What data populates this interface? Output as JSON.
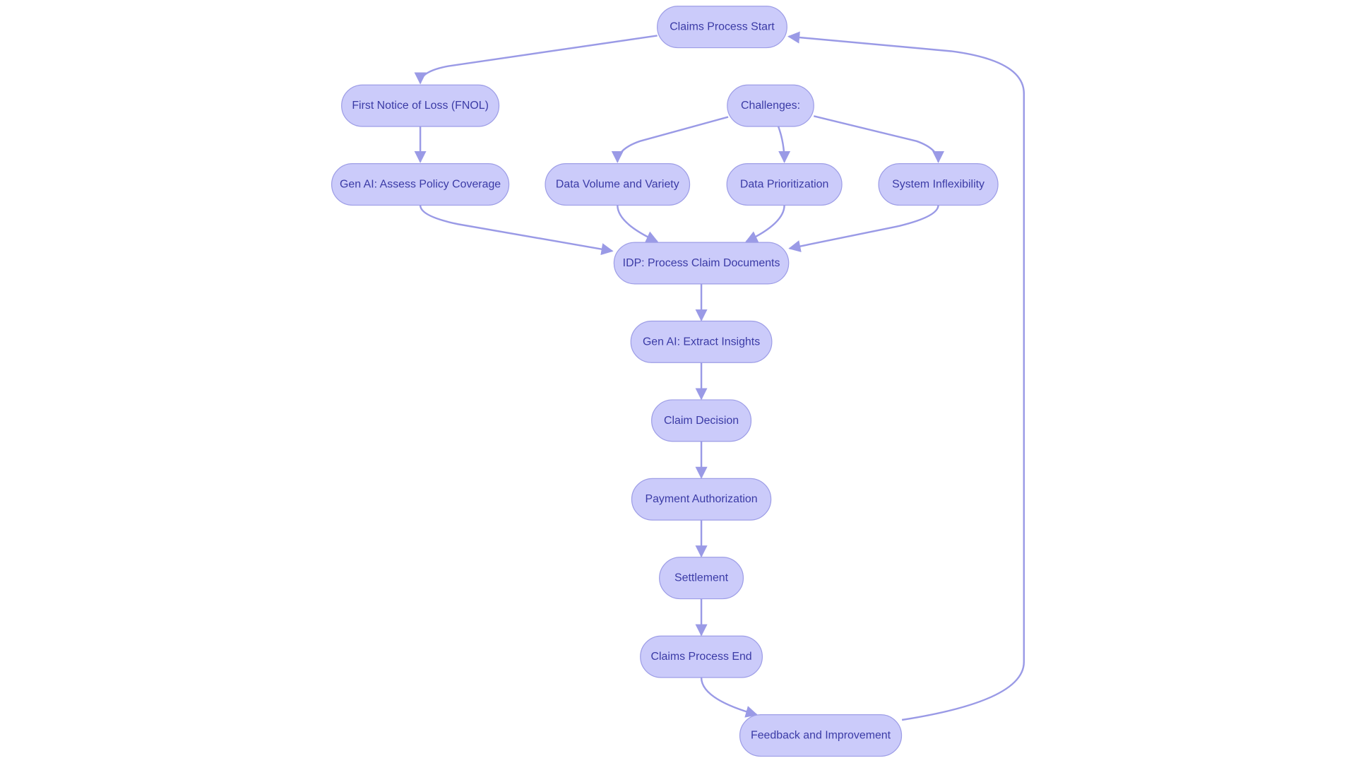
{
  "diagram": {
    "type": "flowchart",
    "colors": {
      "node_fill": "#cbcbfa",
      "node_stroke": "#9d9de6",
      "text": "#3b3ba6",
      "edge": "#9a9ae6"
    },
    "nodes": [
      {
        "id": "start",
        "label": "Claims Process Start"
      },
      {
        "id": "fnol",
        "label": "First Notice of Loss (FNOL)"
      },
      {
        "id": "challenges",
        "label": "Challenges:"
      },
      {
        "id": "assess",
        "label": "Gen AI: Assess Policy Coverage"
      },
      {
        "id": "volume",
        "label": "Data Volume and Variety"
      },
      {
        "id": "prior",
        "label": "Data Prioritization"
      },
      {
        "id": "inflex",
        "label": "System Inflexibility"
      },
      {
        "id": "idp",
        "label": "IDP: Process Claim Documents"
      },
      {
        "id": "extract",
        "label": "Gen AI: Extract Insights"
      },
      {
        "id": "decision",
        "label": "Claim Decision"
      },
      {
        "id": "payment",
        "label": "Payment Authorization"
      },
      {
        "id": "settle",
        "label": "Settlement"
      },
      {
        "id": "end",
        "label": "Claims Process End"
      },
      {
        "id": "feedback",
        "label": "Feedback and Improvement"
      }
    ],
    "edges": [
      {
        "from": "start",
        "to": "fnol"
      },
      {
        "from": "fnol",
        "to": "assess"
      },
      {
        "from": "challenges",
        "to": "volume"
      },
      {
        "from": "challenges",
        "to": "prior"
      },
      {
        "from": "challenges",
        "to": "inflex"
      },
      {
        "from": "assess",
        "to": "idp"
      },
      {
        "from": "volume",
        "to": "idp"
      },
      {
        "from": "prior",
        "to": "idp"
      },
      {
        "from": "inflex",
        "to": "idp"
      },
      {
        "from": "idp",
        "to": "extract"
      },
      {
        "from": "extract",
        "to": "decision"
      },
      {
        "from": "decision",
        "to": "payment"
      },
      {
        "from": "payment",
        "to": "settle"
      },
      {
        "from": "settle",
        "to": "end"
      },
      {
        "from": "end",
        "to": "feedback"
      },
      {
        "from": "feedback",
        "to": "start"
      }
    ]
  }
}
